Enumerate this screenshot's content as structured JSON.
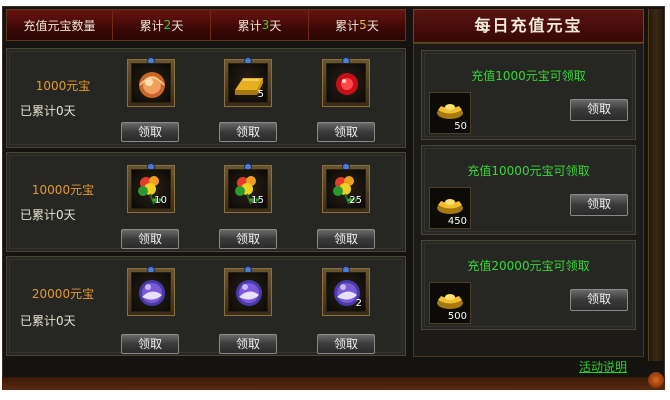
{
  "header": {
    "col1": "充值元宝数量",
    "col2_prefix": "累计",
    "col2_num": "2",
    "col2_suffix": "天",
    "col3_prefix": "累计",
    "col3_num": "3",
    "col3_suffix": "天",
    "col4_prefix": "累计",
    "col4_num": "5",
    "col4_suffix": "天"
  },
  "rows": [
    {
      "amount": "1000元宝",
      "days": "已累计0天",
      "items": [
        {
          "icon": "amber-orb-icon",
          "count": ""
        },
        {
          "icon": "gold-bar-icon",
          "count": "5"
        },
        {
          "icon": "red-pill-icon",
          "count": ""
        }
      ],
      "claim_label": "领取"
    },
    {
      "amount": "10000元宝",
      "days": "已累计0天",
      "items": [
        {
          "icon": "rainbow-flower-icon",
          "count": "10"
        },
        {
          "icon": "rainbow-flower-icon",
          "count": "15"
        },
        {
          "icon": "rainbow-flower-icon",
          "count": "25"
        }
      ],
      "claim_label": "领取"
    },
    {
      "amount": "20000元宝",
      "days": "已累计0天",
      "items": [
        {
          "icon": "purple-orb-icon",
          "count": ""
        },
        {
          "icon": "purple-orb-icon",
          "count": ""
        },
        {
          "icon": "purple-orb-icon",
          "count": "2"
        }
      ],
      "claim_label": "领取"
    }
  ],
  "right": {
    "title": "每日充值元宝",
    "rewards": [
      {
        "text": "充值1000元宝可领取",
        "count": "50",
        "claim_label": "领取"
      },
      {
        "text": "充值10000元宝可领取",
        "count": "450",
        "claim_label": "领取"
      },
      {
        "text": "充值20000元宝可领取",
        "count": "500",
        "claim_label": "领取"
      }
    ]
  },
  "footer": {
    "link": "活动说明"
  },
  "colors": {
    "amount": "#e39a2d",
    "green_text": "#34d83a",
    "header_red": "#5a1410"
  }
}
